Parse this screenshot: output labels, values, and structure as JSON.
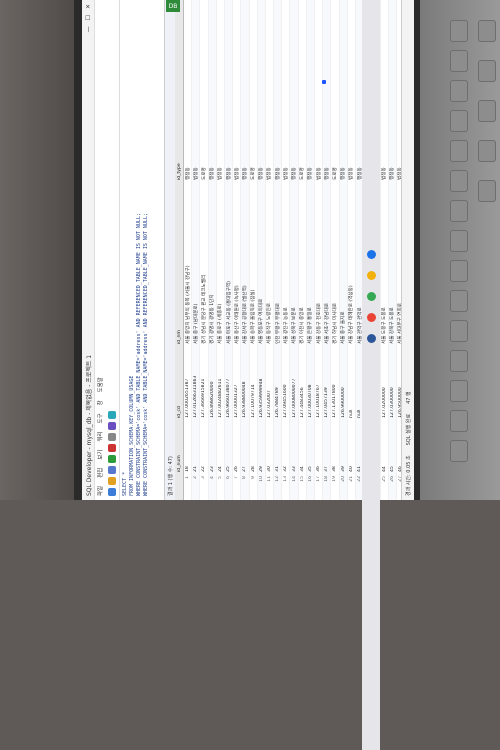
{
  "window": {
    "title": "SQL Developer - mysql_db - 제목없음 - 프로젝트 1",
    "tab_badge": "DB"
  },
  "menu": [
    "파일",
    "편집",
    "보기",
    "쿼리",
    "도구",
    "창",
    "도움말"
  ],
  "editor": {
    "lines": [
      "SELECT *",
      "FROM INFORMATION_SCHEMA.KEY_COLUMN_USAGE",
      "WHERE   CONSTRAINT_SCHEMA='cosk'   AND TABLE_NAME='address'   AND REFERENCED_TABLE_NAME IS NOT NULL;",
      "WHERE   CONSTRAINT_SCHEMA='cosk'   AND TABLE_NAME='address'   AND REFERENCED_TABLE_NAME IS NOT NULL;"
    ]
  },
  "result": {
    "label": "결과 1 (행 수: 47)",
    "columns": [
      "",
      "id_num",
      "id_cd",
      "id_nm",
      "id_type"
    ],
    "rows": [
      [
        "1",
        "18",
        "127.0002651387",
        "서울 중앙지 남부의 동쪽 (서울시 강남구)",
        "행정동"
      ],
      [
        "2",
        "21",
        "127.01266311863",
        "서울 중구 (남대문로)",
        "법정동"
      ],
      [
        "3",
        "22",
        "127.3666915821",
        "경기 성남시 분당구 판교 테크노밸리",
        "도로명"
      ],
      [
        "4",
        "23",
        "126.898620000",
        "경기 광명시 광명동 1단지",
        "행정동"
      ],
      [
        "5",
        "24",
        "127.0024882611",
        "서울 종로구 (세종로)",
        "법정동"
      ],
      [
        "6",
        "25",
        "126.9660138077",
        "서울 마포구 서교동 (홍대입구역)",
        "행정동"
      ],
      [
        "7",
        "26",
        "127.00001327",
        "서울 용산구 이태원로 (녹사평)",
        "법정동"
      ],
      [
        "8",
        "27",
        "126.938800048",
        "서울 강서구 공항대로 (발산역)",
        "행정동"
      ],
      [
        "9",
        "28",
        "127.10079714",
        "서울 송파구 올림픽로 (잠실)",
        "도로명"
      ],
      [
        "10",
        "29",
        "126.9359999948",
        "서울 영등포구 여의대로",
        "행정동"
      ],
      [
        "11",
        "30",
        "127.032007",
        "서울 동작구 노량진로",
        "법정동"
      ],
      [
        "12",
        "31",
        "126.7884789",
        "인천 부평구 부평대로",
        "행정동"
      ],
      [
        "13",
        "32",
        "127.09451600",
        "서울 광진구 능동로",
        "법정동"
      ],
      [
        "14",
        "33",
        "127.0008000077",
        "서울 성북구 보문로",
        "행정동"
      ],
      [
        "15",
        "34",
        "127.4483456",
        "경기 이천시 중앙로",
        "도로명"
      ],
      [
        "16",
        "35",
        "127.00030708",
        "서울 은평구 통일로",
        "행정동"
      ],
      [
        "17",
        "36",
        "127.10018767",
        "서울 강동구 천호대로",
        "법정동"
      ],
      [
        "18",
        "37",
        "127.0457139",
        "서울 서초구 강남대로",
        "행정동"
      ],
      [
        "19",
        "38",
        "127.13017800",
        "경기 하남시 미사대로",
        "도로명"
      ],
      [
        "20",
        "39",
        "126.9900000",
        "서울 중구 을지로",
        "행정동"
      ],
      [
        "21",
        "40",
        "null",
        "서울 강남구 테헤란로 (역삼동)",
        "법정동"
      ],
      [
        "22",
        "41",
        "null",
        "서울 관악구 관악로",
        "행정동"
      ],
      [
        "23",
        "42",
        "126.8300000",
        "서울 양천구 목동로",
        "도로명"
      ],
      [
        "24",
        "43",
        "127.0400000",
        "서울 노원구 동일로",
        "행정동"
      ],
      [
        "25",
        "44",
        "127.0200000",
        "서울 도봉구 도봉로",
        "법정동"
      ],
      [
        "26",
        "45",
        "127.0300000",
        "서울 강북구 도봉로",
        "행정동"
      ],
      [
        "27",
        "46",
        "126.9500000",
        "서울 서대문구 연희로",
        "법정동"
      ],
      [
        "28",
        "47",
        "127.1000000",
        "경기 성남시 분당구",
        "행정동"
      ]
    ]
  },
  "status": {
    "left": "경과 시간: 0.05 초",
    "center": "SQL 실행 완료",
    "right": "47 행"
  },
  "colors": {
    "accent_green": "#2e8b3a",
    "keyword_blue": "#1b1bd0"
  }
}
